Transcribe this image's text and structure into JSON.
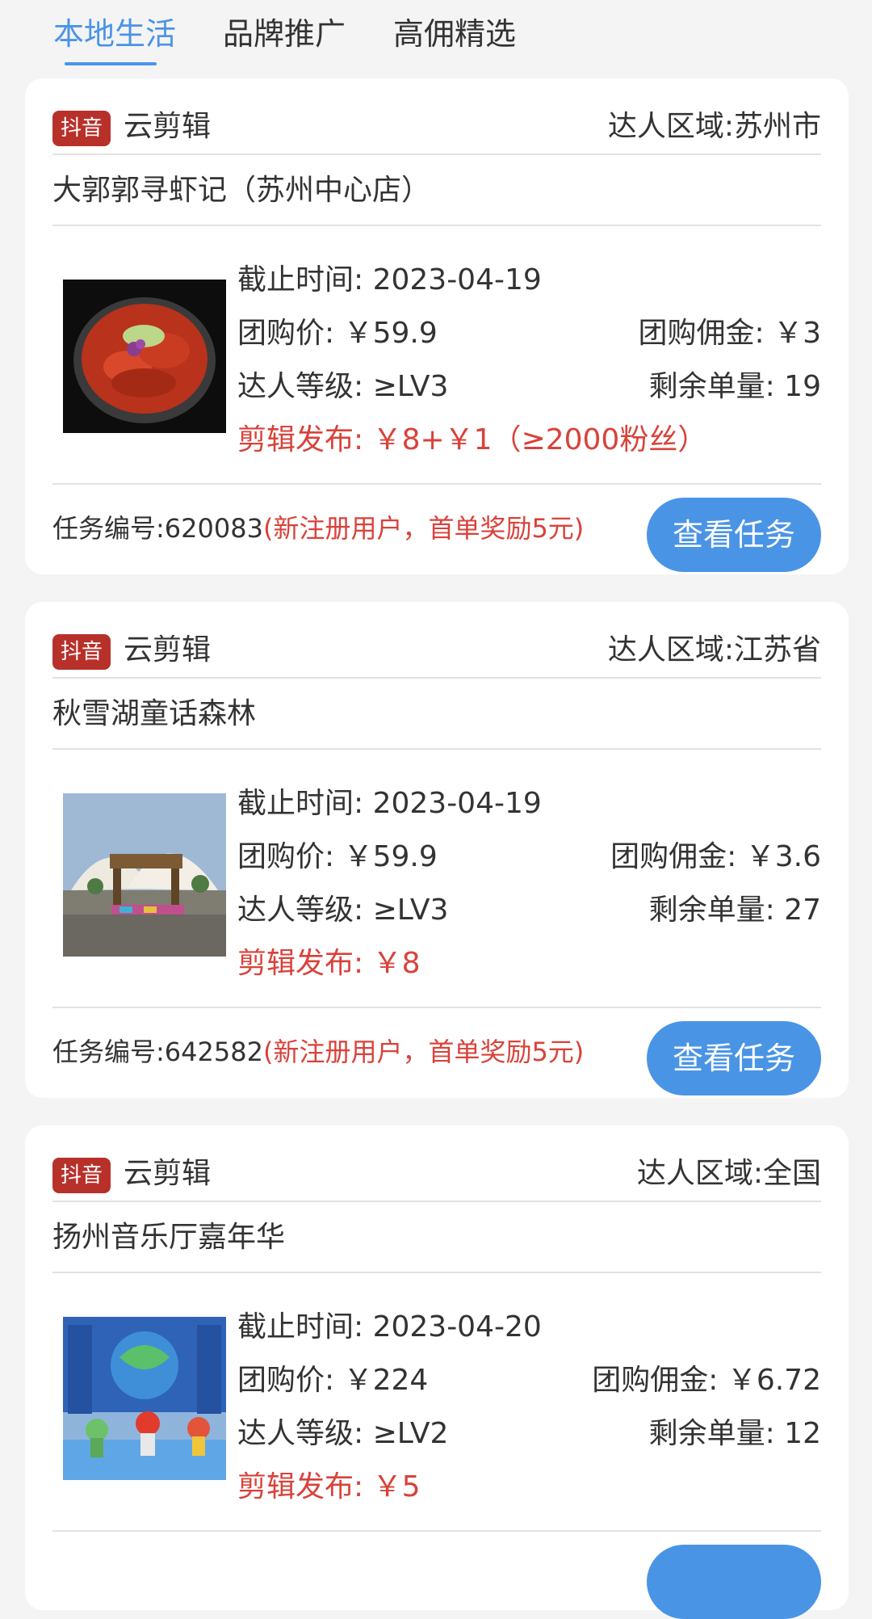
{
  "tabs": [
    {
      "label": "本地生活",
      "active": true
    },
    {
      "label": "品牌推广",
      "active": false
    },
    {
      "label": "高佣精选",
      "active": false
    }
  ],
  "labels": {
    "deadline": "截止时间: ",
    "group_price": "团购价: ",
    "commission": "团购佣金: ",
    "level": "达人等级: ",
    "remaining": "剩余单量: ",
    "publish": "剪辑发布: ",
    "task_no": "任务编号:",
    "view_button": "查看任务"
  },
  "colors": {
    "accent": "#4a94e6",
    "badge": "#b8302a",
    "highlight_red": "#d9423a"
  },
  "cards": [
    {
      "platform": "抖音",
      "app": "云剪辑",
      "region": "达人区域:苏州市",
      "title": "大郭郭寻虾记（苏州中心店）",
      "thumb_icon": "crayfish-dish-image",
      "deadline": "截止时间: 2023-04-19",
      "group_price": "团购价: ￥59.9",
      "commission": "团购佣金: ￥3",
      "level": "达人等级: ≥LV3",
      "remaining": "剩余单量: 19",
      "publish": "剪辑发布: ￥8+￥1（≥2000粉丝）",
      "task_no": "任务编号:620083",
      "promo": "(新注册用户，首单奖励5元)",
      "button": "查看任务"
    },
    {
      "platform": "抖音",
      "app": "云剪辑",
      "region": "达人区域:江苏省",
      "title": "秋雪湖童话森林",
      "thumb_icon": "park-entrance-image",
      "deadline": "截止时间: 2023-04-19",
      "group_price": "团购价: ￥59.9",
      "commission": "团购佣金: ￥3.6",
      "level": "达人等级: ≥LV3",
      "remaining": "剩余单量: 27",
      "publish": "剪辑发布: ￥8",
      "task_no": "任务编号:642582",
      "promo": "(新注册用户，首单奖励5元)",
      "button": "查看任务"
    },
    {
      "platform": "抖音",
      "app": "云剪辑",
      "region": "达人区域:全国",
      "title": "扬州音乐厅嘉年华",
      "thumb_icon": "stage-show-image",
      "deadline": "截止时间: 2023-04-20",
      "group_price": "团购价: ￥224",
      "commission": "团购佣金: ￥6.72",
      "level": "达人等级: ≥LV2",
      "remaining": "剩余单量: 12",
      "publish": "剪辑发布: ￥5"
    }
  ]
}
